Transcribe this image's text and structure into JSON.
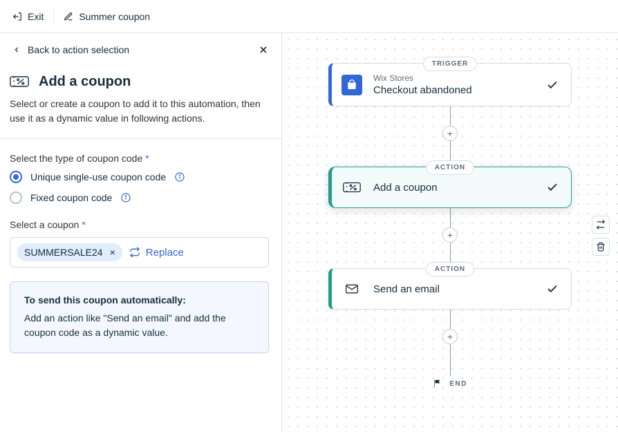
{
  "topbar": {
    "exit_label": "Exit",
    "automation_title": "Summer coupon"
  },
  "sidebar": {
    "back_label": "Back to action selection",
    "heading": "Add a coupon",
    "description": "Select or create a coupon to add it to this automation, then use it as a dynamic value in following actions.",
    "type_label": "Select the type of coupon code",
    "radio_unique": "Unique single-use coupon code",
    "radio_fixed": "Fixed coupon code",
    "select_coupon_label": "Select a coupon",
    "selected_coupon": "SUMMERSALE24",
    "replace_label": "Replace",
    "tip_title": "To send this coupon automatically:",
    "tip_body": "Add an action like \"Send an email\" and add the coupon code as a dynamic value."
  },
  "canvas": {
    "trigger_badge": "TRIGGER",
    "action_badge": "ACTION",
    "end_label": "END",
    "nodes": {
      "trigger": {
        "subtitle": "Wix Stores",
        "title": "Checkout abandoned"
      },
      "coupon": {
        "title": "Add a coupon"
      },
      "email": {
        "title": "Send an email"
      }
    }
  }
}
